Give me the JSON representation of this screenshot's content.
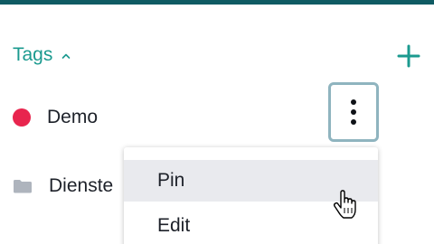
{
  "header": {
    "tags_label": "Tags",
    "chevron_icon": "chevron-up-icon",
    "add_icon": "plus-icon"
  },
  "tags": [
    {
      "label": "Demo",
      "color": "#e8254e",
      "icon": "color-dot-icon"
    },
    {
      "label": "Dienste",
      "icon": "folder-icon"
    }
  ],
  "more_button_icon": "more-vertical-icon",
  "context_menu": {
    "items": [
      {
        "label": "Pin"
      },
      {
        "label": "Edit"
      }
    ]
  },
  "colors": {
    "accent": "#1b9a8f",
    "top_bar": "#0f5b63",
    "focus_border": "#8fb4bf",
    "hover_bg": "#e9eaee"
  }
}
